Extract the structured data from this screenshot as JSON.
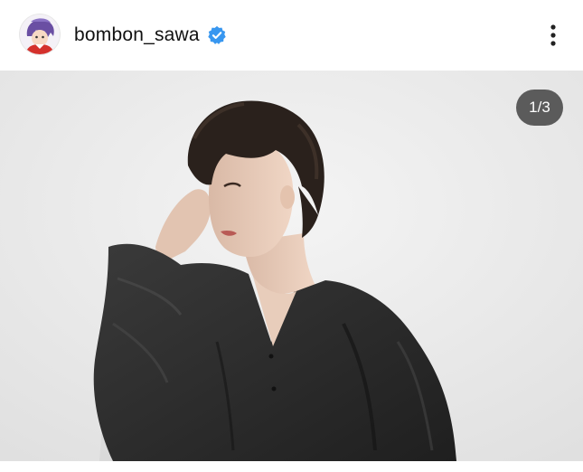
{
  "post": {
    "username": "bombon_sawa",
    "verified": true,
    "image_counter": "1/3"
  },
  "icons": {
    "avatar": "avatar-icon",
    "verified": "verified-badge-icon",
    "more": "more-vertical-icon"
  },
  "colors": {
    "verified": "#3897f0",
    "counter_bg": "#3c3c3c",
    "photo_bg": "#ebebeb",
    "shirt": "#2b2b2b",
    "hair": "#2a211c"
  }
}
